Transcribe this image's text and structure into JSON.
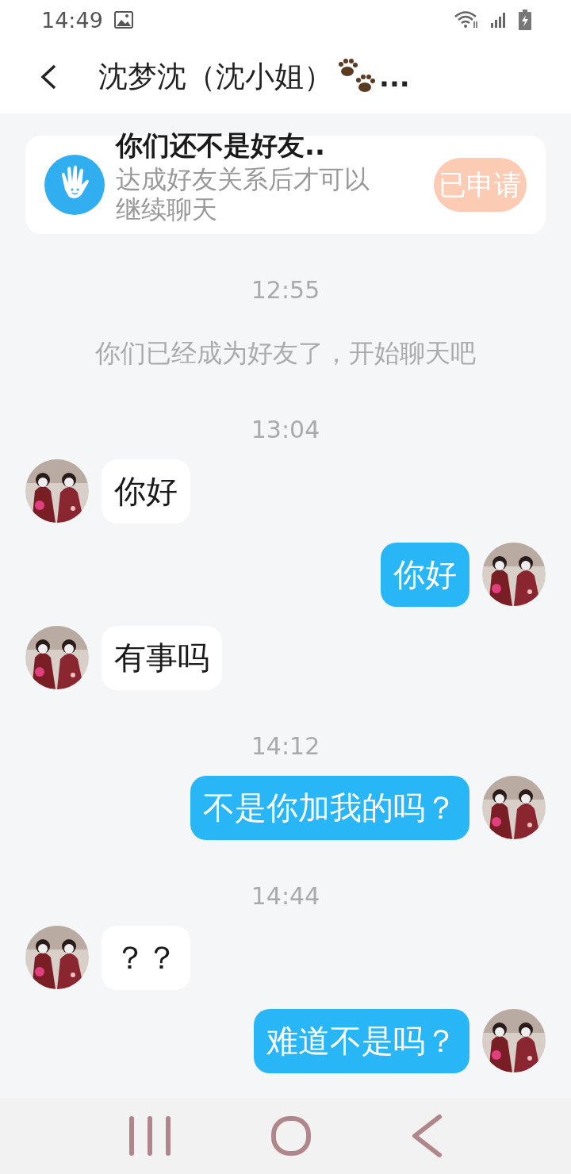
{
  "status_bar": {
    "time": "14:49"
  },
  "header": {
    "title": "沈梦沈（沈小姐）",
    "ellipsis": "..."
  },
  "banner": {
    "title": "你们还不是好友..",
    "subtitle": "达成好友关系后才可以继续聊天",
    "button": "已申请"
  },
  "messages": [
    {
      "kind": "time",
      "text": "12:55"
    },
    {
      "kind": "notice",
      "text": "你们已经成为好友了，开始聊天吧"
    },
    {
      "kind": "time",
      "text": "13:04"
    },
    {
      "kind": "incoming",
      "text": "你好"
    },
    {
      "kind": "outgoing",
      "text": "你好"
    },
    {
      "kind": "incoming",
      "text": "有事吗"
    },
    {
      "kind": "time",
      "text": "14:12"
    },
    {
      "kind": "outgoing",
      "text": "不是你加我的吗？"
    },
    {
      "kind": "time",
      "text": "14:44"
    },
    {
      "kind": "incoming",
      "text": "？？"
    },
    {
      "kind": "outgoing",
      "text": "难道不是吗？"
    }
  ]
}
